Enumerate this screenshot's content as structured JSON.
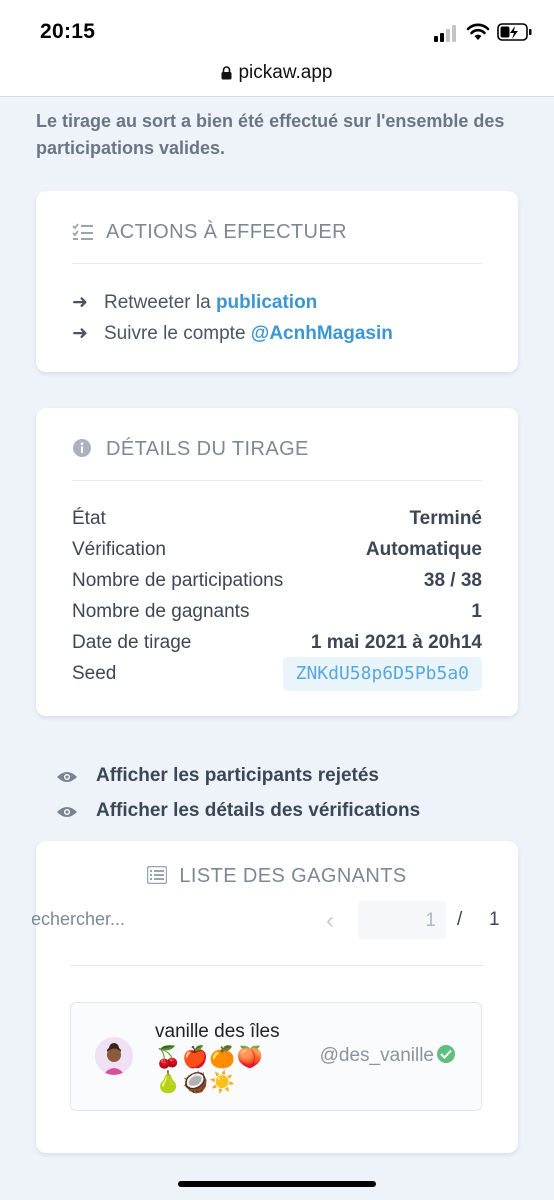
{
  "status_bar": {
    "time": "20:15",
    "url": "pickaw.app"
  },
  "intro_text": "Le tirage au sort a bien été effectué sur l'ensemble des participations valides.",
  "actions": {
    "title": "ACTIONS À EFFECTUER",
    "items": [
      {
        "prefix": "Retweeter la",
        "link": "publication"
      },
      {
        "prefix": "Suivre le compte",
        "link": "@AcnhMagasin"
      }
    ]
  },
  "details": {
    "title": "DÉTAILS DU TIRAGE",
    "rows": [
      {
        "label": "État",
        "value": "Terminé"
      },
      {
        "label": "Vérification",
        "value": "Automatique"
      },
      {
        "label": "Nombre de participations",
        "value": "38 / 38"
      },
      {
        "label": "Nombre de gagnants",
        "value": "1"
      },
      {
        "label": "Date de tirage",
        "value": "1 mai 2021 à 20h14"
      }
    ],
    "seed_label": "Seed",
    "seed_value": "ZNKdU58p6D5Pb5a0"
  },
  "toggles": [
    "Afficher les participants rejetés",
    "Afficher les détails des vérifications"
  ],
  "winners": {
    "title": "LISTE DES GAGNANTS",
    "search_placeholder": "Rechercher...",
    "page_current": "1",
    "page_separator": "/",
    "page_total": "1",
    "items": [
      {
        "name": "vanille des îles",
        "emojis": "🍒🍎🍊🍑🍐🥥☀️",
        "handle": "@des_vanille"
      }
    ]
  },
  "colors": {
    "link": "#3b97d3",
    "background": "#eef3f9",
    "verified": "#5fbf7e"
  }
}
